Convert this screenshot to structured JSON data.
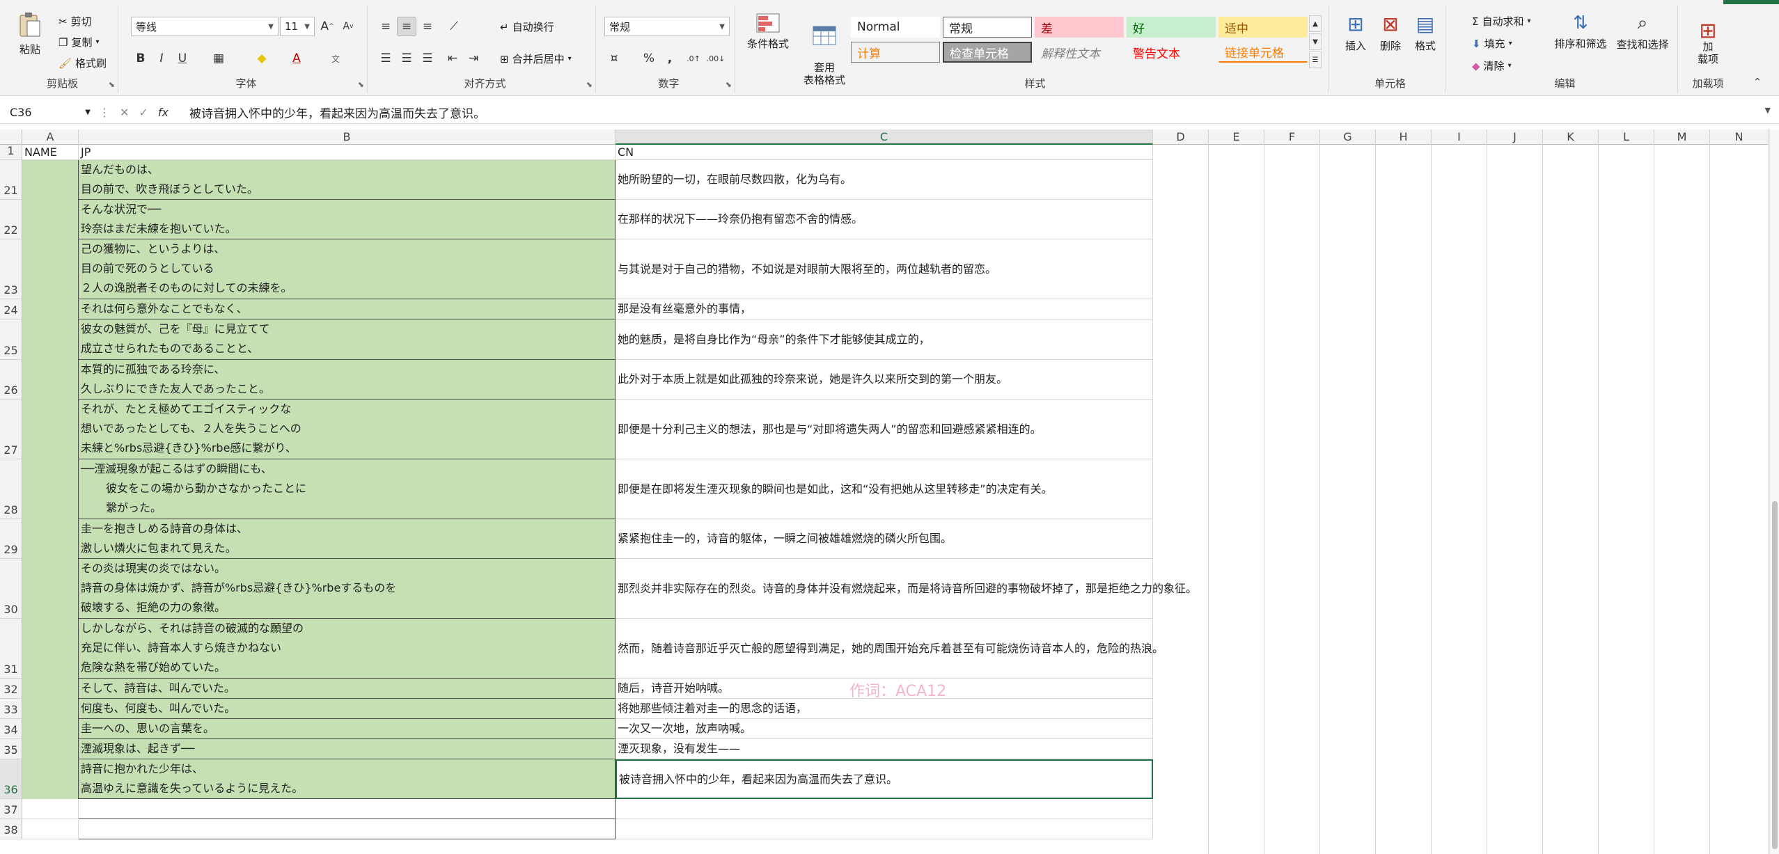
{
  "ribbon": {
    "clipboard": {
      "label": "剪贴板",
      "paste": "粘贴",
      "cut": "剪切",
      "copy": "复制",
      "format_painter": "格式刷"
    },
    "font": {
      "label": "字体",
      "font_name": "等线",
      "font_size": "11",
      "bold": "B",
      "italic": "I",
      "underline": "U"
    },
    "alignment": {
      "label": "对齐方式",
      "wrap_text": "自动换行",
      "merge_center": "合并后居中"
    },
    "number": {
      "label": "数字",
      "format": "常规",
      "percent": "%",
      "comma": "⁹",
      "inc_decimal": "←.0",
      "dec_decimal": ".00"
    },
    "styles": {
      "label": "样式",
      "conditional": "条件格式",
      "table": "套用\n表格格式",
      "cells": [
        {
          "text": "Normal",
          "fg": "#222222",
          "bg": "#ffffff"
        },
        {
          "text": "常规",
          "fg": "#222222",
          "bg": "#ffffff"
        },
        {
          "text": "差",
          "fg": "#9c0006",
          "bg": "#ffc7ce"
        },
        {
          "text": "好",
          "fg": "#006100",
          "bg": "#c6efce"
        },
        {
          "text": "适中",
          "fg": "#9c5700",
          "bg": "#ffeb9c"
        },
        {
          "text": "计算",
          "fg": "#fa7d00",
          "bg": "#f2f2f2"
        },
        {
          "text": "检查单元格",
          "fg": "#ffffff",
          "bg": "#a5a5a5"
        },
        {
          "text": "解释性文本",
          "fg": "#7f7f7f",
          "bg": "#f3f3f3"
        },
        {
          "text": "警告文本",
          "fg": "#ff0000",
          "bg": "#f3f3f3"
        },
        {
          "text": "链接单元格",
          "fg": "#fa7d00",
          "bg": "#f3f3f3"
        }
      ]
    },
    "cells_group": {
      "label": "单元格",
      "insert": "插入",
      "delete": "删除",
      "format": "格式"
    },
    "editing": {
      "label": "编辑",
      "autosum": "自动求和",
      "fill": "填充",
      "clear": "清除",
      "sort_filter": "排序和筛选",
      "find_select": "查找和选择"
    },
    "addins": {
      "label": "加载项",
      "addin": "加\n载项"
    }
  },
  "formula_bar": {
    "name_box": "C36",
    "content": "被诗音拥入怀中的少年，看起来因为高温而失去了意识。"
  },
  "sheet": {
    "columns": [
      "A",
      "B",
      "C",
      "D",
      "E",
      "F",
      "G",
      "H",
      "I",
      "J",
      "K",
      "L",
      "M",
      "N"
    ],
    "header_row": {
      "number": "1",
      "a": "NAME",
      "b": "JP",
      "c": "CN"
    },
    "rows": [
      {
        "n": "21",
        "jp": "望んだものは、\n目の前で、吹き飛ぼうとしていた。",
        "cn": "她所盼望的一切，在眼前尽数四散，化为乌有。"
      },
      {
        "n": "22",
        "jp": "そんな状況で──\n玲奈はまだ未練を抱いていた。",
        "cn": "在那样的状况下——玲奈仍抱有留恋不舍的情感。"
      },
      {
        "n": "23",
        "jp": "己の獲物に、というよりは、\n目の前で死のうとしている\n２人の逸脱者そのものに対しての未練を。",
        "cn": "与其说是对于自己的猎物，不如说是对眼前大限将至的，两位越轨者的留恋。"
      },
      {
        "n": "24",
        "jp": "それは何ら意外なことでもなく、",
        "cn": "那是没有丝毫意外的事情，"
      },
      {
        "n": "25",
        "jp": "彼女の魅質が、己を『母』に見立てて\n成立させられたものであることと、",
        "cn": "她的魅质，是将自身比作为“母亲”的条件下才能够使其成立的，"
      },
      {
        "n": "26",
        "jp": "本質的に孤独である玲奈に、\n久しぶりにできた友人であったこと。",
        "cn": "此外对于本质上就是如此孤独的玲奈来说，她是许久以来所交到的第一个朋友。"
      },
      {
        "n": "27",
        "jp": "それが、たとえ極めてエゴイスティックな\n想いであったとしても、２人を失うことへの\n未練と%rbs忌避{きひ}%rbe感に繋がり、",
        "cn": "即便是十分利己主义的想法，那也是与“对即将遗失两人”的留恋和回避感紧紧相连的。"
      },
      {
        "n": "28",
        "jp": "──湮滅現象が起こるはずの瞬間にも、\n彼女をこの場から動かさなかったことに\n繋がった。",
        "cn": "即便是在即将发生湮灭现象的瞬间也是如此，这和“没有把她从这里转移走”的决定有关。"
      },
      {
        "n": "29",
        "jp": "圭一を抱きしめる詩音の身体は、\n激しい燐火に包まれて見えた。",
        "cn": "紧紧抱住圭一的，诗音的躯体，一瞬之间被雄雄燃烧的磷火所包围。"
      },
      {
        "n": "30",
        "jp": "その炎は現実の炎ではない。\n詩音の身体は焼かず、詩音が%rbs忌避{きひ}%rbeするものを\n破壊する、拒絶の力の象徴。",
        "cn": "那烈炎并非实际存在的烈炎。诗音的身体并没有燃烧起来，而是将诗音所回避的事物破坏掉了，那是拒绝之力的象征。"
      },
      {
        "n": "31",
        "jp": "しかしながら、それは詩音の破滅的な願望の\n充足に伴い、詩音本人すら焼きかねない\n危険な熱を帯び始めていた。",
        "cn": "然而，随着诗音那近乎灭亡般的愿望得到满足，她的周围开始充斥着甚至有可能烧伤诗音本人的，危险的热浪。"
      },
      {
        "n": "32",
        "jp": "そして、詩音は、叫んでいた。",
        "cn": "随后，诗音开始呐喊。"
      },
      {
        "n": "33",
        "jp": "何度も、何度も、叫んでいた。",
        "cn": "将她那些倾注着对圭一的思念的话语，"
      },
      {
        "n": "34",
        "jp": "圭一への、思いの言葉を。",
        "cn": "一次又一次地，放声呐喊。"
      },
      {
        "n": "35",
        "jp": "湮滅現象は、起きず──",
        "cn": "湮灭现象，没有发生——"
      },
      {
        "n": "36",
        "jp": "詩音に抱かれた少年は、\n高温ゆえに意識を失っているように見えた。",
        "cn": "被诗音拥入怀中的少年，看起来因为高温而失去了意识。"
      },
      {
        "n": "37",
        "jp": "",
        "cn": ""
      },
      {
        "n": "38",
        "jp": "",
        "cn": ""
      }
    ]
  },
  "watermark": "作词：ACA12"
}
